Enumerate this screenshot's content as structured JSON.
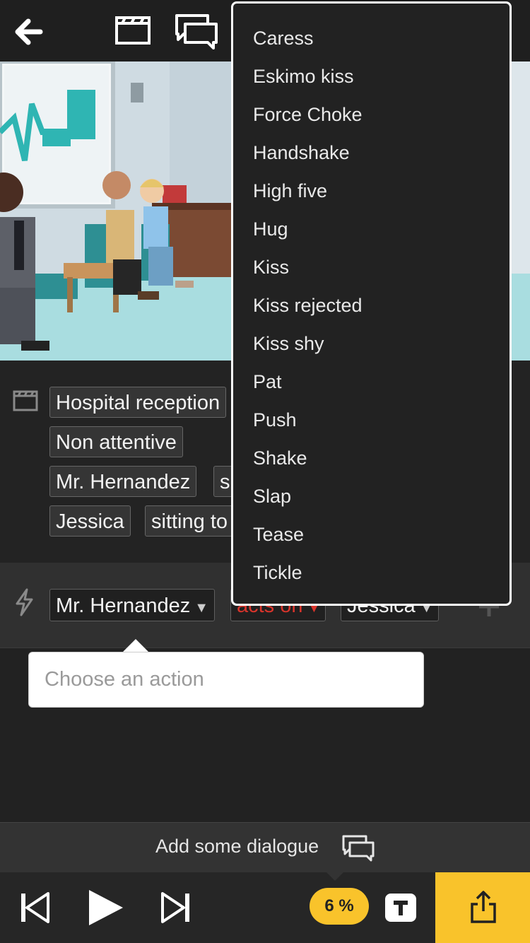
{
  "toolbar": {
    "back_icon": "arrow-left-icon",
    "scene_icon": "clapperboard-icon",
    "dialogue_icon": "speech-bubbles-icon"
  },
  "setup": {
    "scene_icon": "clapperboard-icon",
    "tags": [
      "Hospital reception",
      "Non attentive",
      "Mr. Hernandez",
      "s",
      "Jessica",
      "sitting to"
    ]
  },
  "action_row": {
    "icon": "lightning-icon",
    "subject": "Mr. Hernandez",
    "verb": "acts on",
    "object": "Jessica",
    "add_icon": "plus-icon"
  },
  "action_input": {
    "placeholder": "Choose an action"
  },
  "dialogue": {
    "label": "Add some dialogue",
    "icon": "speech-bubbles-icon"
  },
  "playback": {
    "prev_icon": "skip-previous-icon",
    "play_icon": "play-icon",
    "next_icon": "skip-next-icon",
    "progress_label": "6 %",
    "progress_value": 0.06,
    "text_icon": "text-t-icon",
    "share_icon": "share-icon"
  },
  "action_menu": {
    "items": [
      "Caress",
      "Eskimo kiss",
      "Force Choke",
      "Handshake",
      "High five",
      "Hug",
      "Kiss",
      "Kiss rejected",
      "Kiss shy",
      "Pat",
      "Push",
      "Shake",
      "Slap",
      "Tease",
      "Tickle"
    ]
  },
  "colors": {
    "accent": "#F9C32B",
    "background": "#222222",
    "verb_red": "#D9342B"
  }
}
